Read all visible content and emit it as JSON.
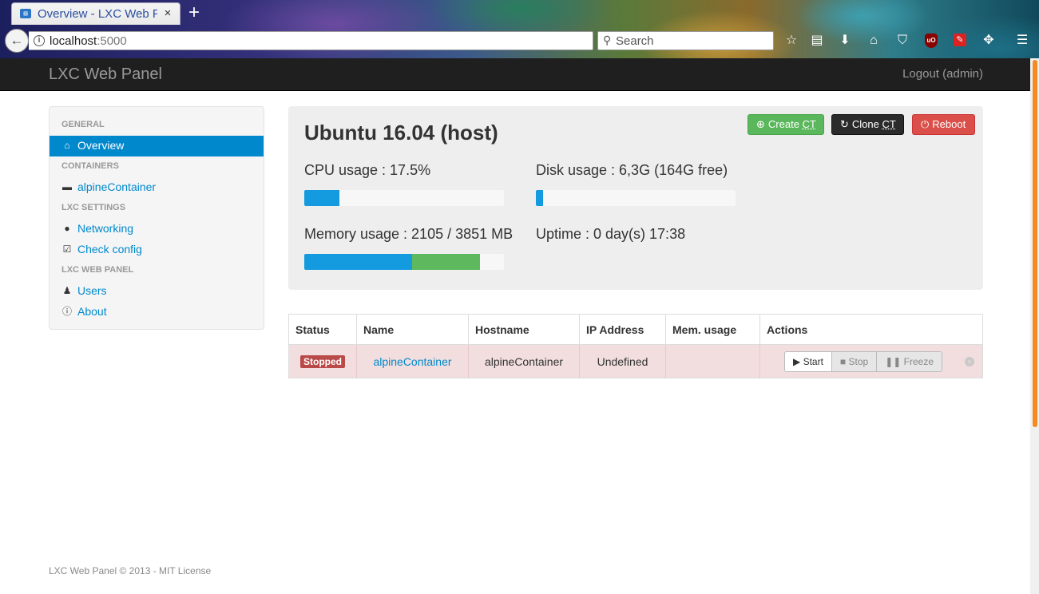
{
  "browser": {
    "tab_title": "Overview - LXC Web Panel",
    "tab_close": "×",
    "new_tab": "+",
    "url_host": "localhost",
    "url_port": ":5000",
    "search_placeholder": "Search"
  },
  "app": {
    "brand": "LXC Web Panel",
    "logout_label": "Logout (admin)"
  },
  "sidebar": {
    "sections": [
      {
        "header": "GENERAL",
        "items": [
          {
            "label": "Overview",
            "icon": "home-icon",
            "active": true
          }
        ]
      },
      {
        "header": "CONTAINERS",
        "items": [
          {
            "label": "alpineContainer",
            "icon": "hdd-icon",
            "active": false
          }
        ]
      },
      {
        "header": "LXC SETTINGS",
        "items": [
          {
            "label": "Networking",
            "icon": "globe-icon",
            "active": false
          },
          {
            "label": "Check config",
            "icon": "check-icon",
            "active": false
          }
        ]
      },
      {
        "header": "LXC WEB PANEL",
        "items": [
          {
            "label": "Users",
            "icon": "user-icon",
            "active": false
          },
          {
            "label": "About",
            "icon": "info-icon",
            "active": false
          }
        ]
      }
    ]
  },
  "host": {
    "title": "Ubuntu 16.04 (host)",
    "create_label": "Create ",
    "create_ct": "CT",
    "clone_label": "Clone ",
    "clone_ct": "CT",
    "reboot_label": "Reboot",
    "cpu_label": "CPU usage : 17.5%",
    "cpu_fraction": 0.175,
    "disk_label": "Disk usage : 6,3G (164G free)",
    "disk_fraction": 0.037,
    "memory_label": "Memory usage : 2105 / 3851 MB",
    "memory_used_fraction": 0.54,
    "memory_cached_fraction": 0.34,
    "uptime_label": "Uptime : 0 day(s) 17:38"
  },
  "table": {
    "headers": [
      "Status",
      "Name",
      "Hostname",
      "IP Address",
      "Mem. usage",
      "Actions"
    ],
    "rows": [
      {
        "status": "Stopped",
        "name": "alpineContainer",
        "hostname": "alpineContainer",
        "ip": "Undefined",
        "mem": ""
      }
    ],
    "actions": {
      "start": "Start",
      "stop": "Stop",
      "freeze": "Freeze"
    }
  },
  "footer": "LXC Web Panel © 2013 - MIT License"
}
